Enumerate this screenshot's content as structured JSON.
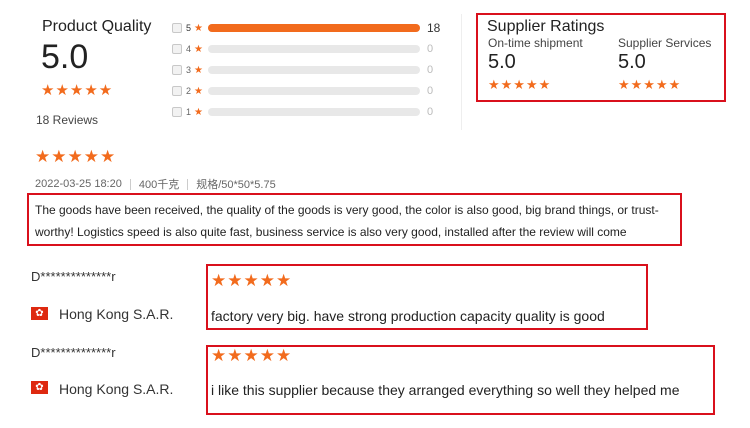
{
  "product_quality": {
    "title": "Product Quality",
    "score": "5.0",
    "stars": "★★★★★",
    "reviews": "18 Reviews"
  },
  "histogram": [
    {
      "star": "5",
      "count": "18",
      "fraction": 1.0
    },
    {
      "star": "4",
      "count": "0",
      "fraction": 0
    },
    {
      "star": "3",
      "count": "0",
      "fraction": 0
    },
    {
      "star": "2",
      "count": "0",
      "fraction": 0
    },
    {
      "star": "1",
      "count": "0",
      "fraction": 0
    }
  ],
  "supplier_ratings": {
    "title": "Supplier Ratings",
    "ontime_label": "On-time shipment",
    "ontime_score": "5.0",
    "services_label": "Supplier Services",
    "services_score": "5.0",
    "stars": "★★★★★"
  },
  "review": {
    "stars": "★★★★★",
    "date": "2022-03-25 18:20",
    "weight": "400千克",
    "spec": "规格/50*50*5.75",
    "text": "The goods have been received, the quality of the goods is very good, the color is also good, big brand things, or trust-worthy! Logistics speed is also quite fast, business service is also very good, installed after the review will come"
  },
  "buyers": [
    {
      "name": "D**************r",
      "flag": "✿",
      "country": "Hong Kong S.A.R.",
      "stars": "★★★★★",
      "text": "factory very big. have strong production capacity quality is good"
    },
    {
      "name": "D**************r",
      "flag": "✿",
      "country": "Hong Kong S.A.R.",
      "stars": "★★★★★",
      "text": "i like this supplier because they arranged everything so well they helped me"
    }
  ],
  "colors": {
    "accent": "#f26b1d",
    "highlight_border": "#d9101c",
    "flag_red": "#de2910"
  }
}
